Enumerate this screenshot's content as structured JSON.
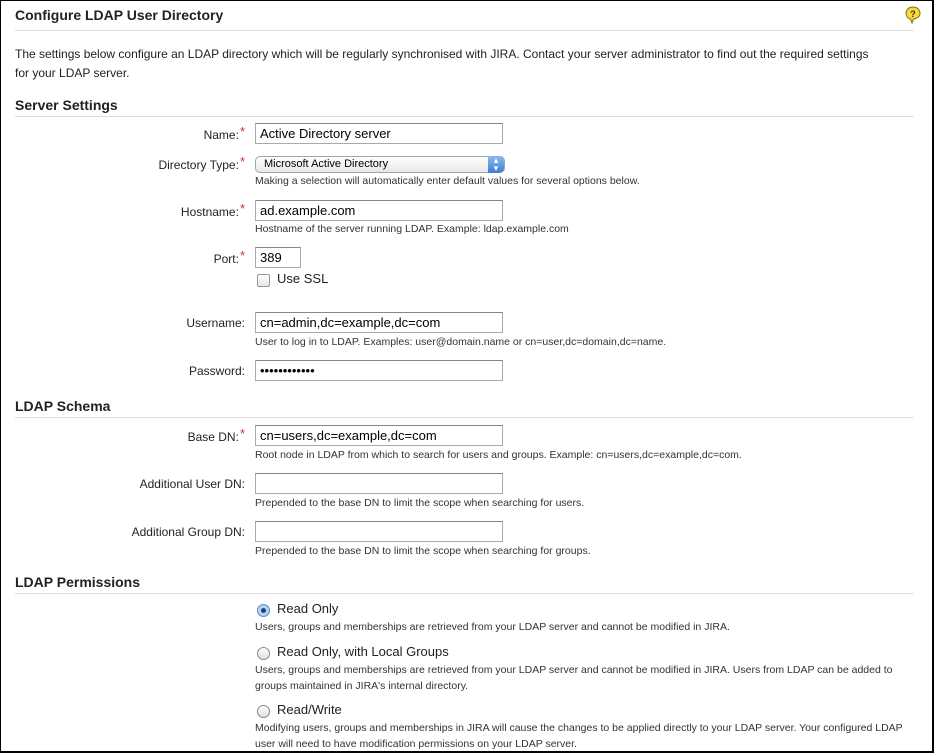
{
  "header": {
    "title": "Configure LDAP User Directory",
    "help_icon": "help-bubble-icon"
  },
  "intro": "The settings below configure an LDAP directory which will be regularly synchronised with JIRA. Contact your server administrator to find out the required settings for your LDAP server.",
  "required_marker": "*",
  "server_settings": {
    "heading": "Server Settings",
    "name": {
      "label": "Name:",
      "value": "Active Directory server"
    },
    "directory_type": {
      "label": "Directory Type:",
      "selected": "Microsoft Active Directory",
      "hint": "Making a selection will automatically enter default values for several options below."
    },
    "hostname": {
      "label": "Hostname:",
      "value": "ad.example.com",
      "hint": "Hostname of the server running LDAP. Example: ldap.example.com"
    },
    "port": {
      "label": "Port:",
      "value": "389"
    },
    "use_ssl": {
      "label": "Use SSL",
      "checked": false
    },
    "username": {
      "label": "Username:",
      "value": "cn=admin,dc=example,dc=com",
      "hint": "User to log in to LDAP. Examples: user@domain.name or cn=user,dc=domain,dc=name."
    },
    "password": {
      "label": "Password:",
      "value": "••••••••••••"
    }
  },
  "ldap_schema": {
    "heading": "LDAP Schema",
    "base_dn": {
      "label": "Base DN:",
      "value": "cn=users,dc=example,dc=com",
      "hint": "Root node in LDAP from which to search for users and groups. Example: cn=users,dc=example,dc=com."
    },
    "additional_user_dn": {
      "label": "Additional User DN:",
      "value": "",
      "hint": "Prepended to the base DN to limit the scope when searching for users."
    },
    "additional_group_dn": {
      "label": "Additional Group DN:",
      "value": "",
      "hint": "Prepended to the base DN to limit the scope when searching for groups."
    }
  },
  "ldap_permissions": {
    "heading": "LDAP Permissions",
    "selected": "Read Only",
    "options": [
      {
        "label": "Read Only",
        "description": "Users, groups and memberships are retrieved from your LDAP server and cannot be modified in JIRA."
      },
      {
        "label": "Read Only, with Local Groups",
        "description": "Users, groups and memberships are retrieved from your LDAP server and cannot be modified in JIRA. Users from LDAP can be added to groups maintained in JIRA's internal directory."
      },
      {
        "label": "Read/Write",
        "description": "Modifying users, groups and memberships in JIRA will cause the changes to be applied directly to your LDAP server. Your configured LDAP user will need to have modification permissions on your LDAP server."
      }
    ]
  }
}
